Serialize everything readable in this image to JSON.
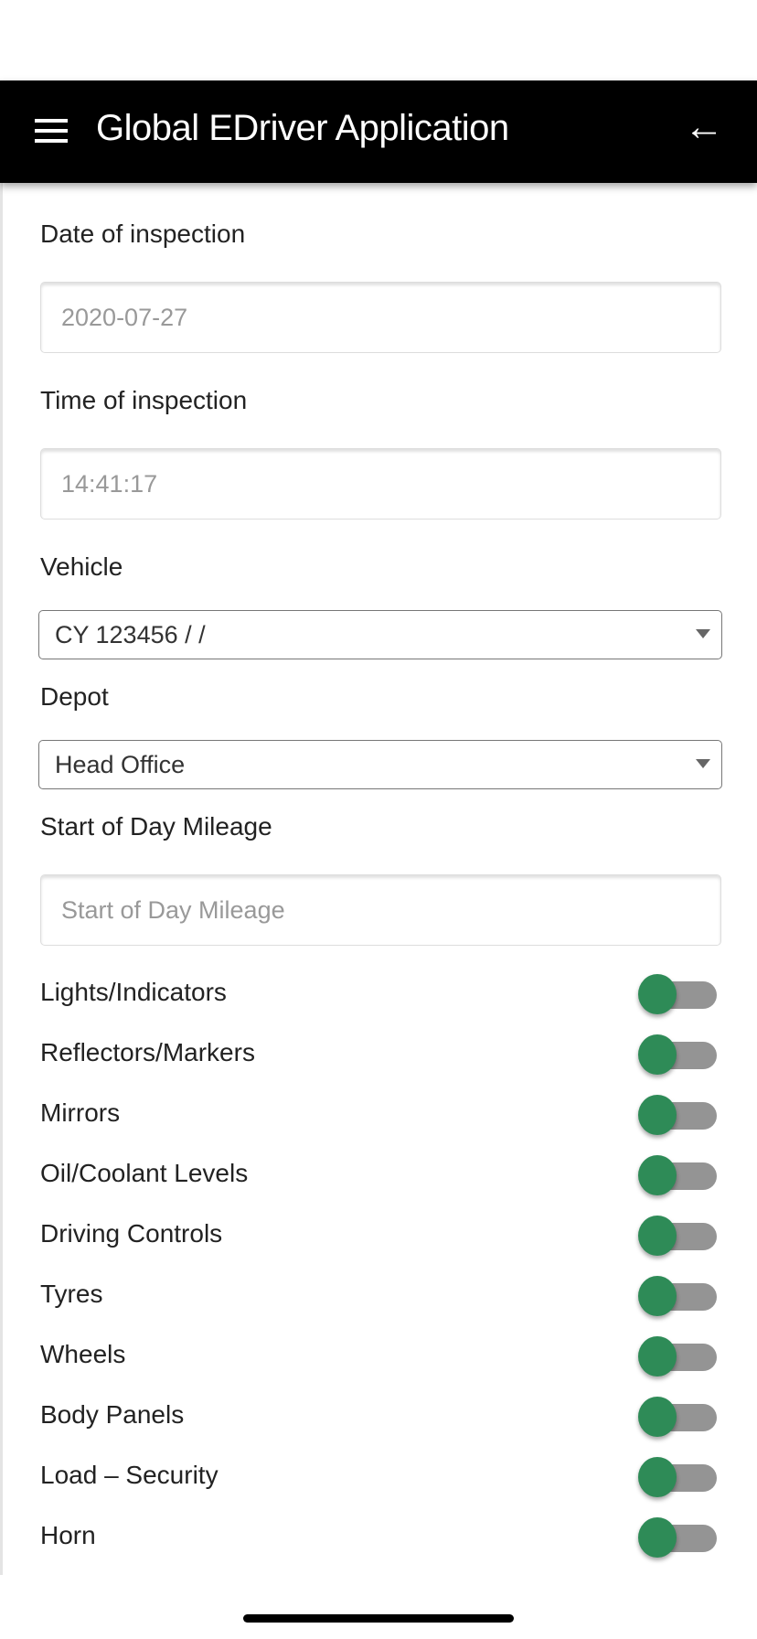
{
  "header": {
    "title": "Global EDriver Application",
    "menu_icon": "hamburger-menu-icon",
    "back_icon": "arrow-left-icon"
  },
  "form": {
    "date_label": "Date of inspection",
    "date_value": "2020-07-27",
    "time_label": "Time of inspection",
    "time_value": "14:41:17",
    "vehicle_label": "Vehicle",
    "vehicle_value": "CY 123456 / /",
    "depot_label": "Depot",
    "depot_value": "Head Office",
    "mileage_label": "Start of Day Mileage",
    "mileage_placeholder": "Start of Day Mileage",
    "mileage_value": ""
  },
  "checks": [
    {
      "label": "Lights/Indicators",
      "on": false
    },
    {
      "label": "Reflectors/Markers",
      "on": false
    },
    {
      "label": "Mirrors",
      "on": false
    },
    {
      "label": "Oil/Coolant Levels",
      "on": false
    },
    {
      "label": "Driving Controls",
      "on": false
    },
    {
      "label": "Tyres",
      "on": false
    },
    {
      "label": "Wheels",
      "on": false
    },
    {
      "label": "Body Panels",
      "on": false
    },
    {
      "label": "Load – Security",
      "on": false
    },
    {
      "label": "Horn",
      "on": false
    }
  ],
  "colors": {
    "header": "#000000",
    "toggle_knob": "#2e8b57",
    "toggle_track": "#949494"
  }
}
